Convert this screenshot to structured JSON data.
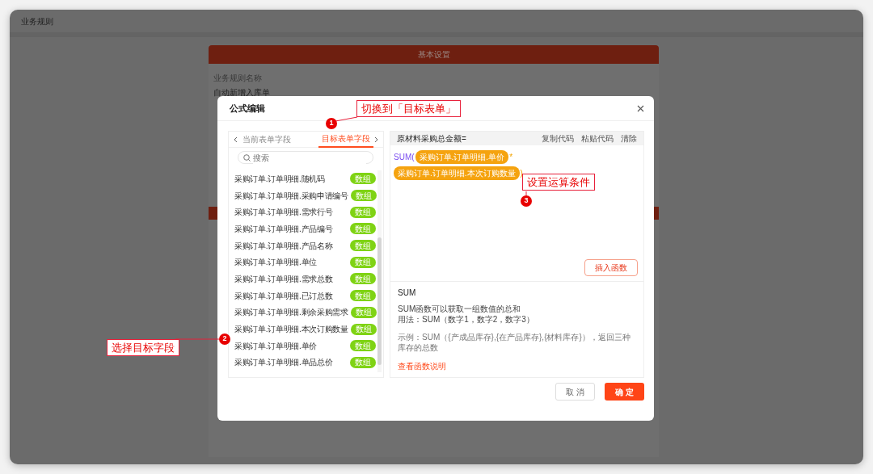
{
  "window": {
    "title": "业务规则"
  },
  "background_form": {
    "section_title": "基本设置",
    "fields": [
      {
        "label": "业务规则名称",
        "value": "自动新增入库单"
      }
    ]
  },
  "dialog": {
    "title": "公式编辑",
    "field_tabs": [
      {
        "label": "当前表单字段",
        "selected": false
      },
      {
        "label": "目标表单字段",
        "selected": true
      }
    ],
    "search": {
      "placeholder": "搜索"
    },
    "fields": [
      {
        "name": "采购订单.订单明细.随机码",
        "badge": "数组"
      },
      {
        "name": "采购订单.订单明细.采购申请编号",
        "badge": "数组"
      },
      {
        "name": "采购订单.订单明细.需求行号",
        "badge": "数组"
      },
      {
        "name": "采购订单.订单明细.产品编号",
        "badge": "数组"
      },
      {
        "name": "采购订单.订单明细.产品名称",
        "badge": "数组"
      },
      {
        "name": "采购订单.订单明细.单位",
        "badge": "数组"
      },
      {
        "name": "采购订单.订单明细.需求总数",
        "badge": "数组"
      },
      {
        "name": "采购订单.订单明细.已订总数",
        "badge": "数组"
      },
      {
        "name": "采购订单.订单明细.剩余采购需求",
        "badge": "数组"
      },
      {
        "name": "采购订单.订单明细.本次订购数量",
        "badge": "数组"
      },
      {
        "name": "采购订单.订单明细.单价",
        "badge": "数组"
      },
      {
        "name": "采购订单.订单明细.单品总价",
        "badge": "数组"
      }
    ],
    "formula": {
      "target": "原材料采购总金额=",
      "actions": [
        "复制代码",
        "粘贴代码",
        "清除"
      ],
      "tokens": [
        {
          "kind": "function",
          "text": "SUM("
        },
        {
          "kind": "field",
          "text": "采购订单.订单明细.单价"
        },
        {
          "kind": "operator",
          "text": "*"
        },
        {
          "kind": "field",
          "text": "采购订单.订单明细.本次订购数量"
        },
        {
          "kind": "operator",
          "text": ")"
        }
      ],
      "insert_button": "插入函数"
    },
    "help": {
      "name": "SUM",
      "lines": [
        "SUM函数可以获取一组数值的总和",
        "用法：SUM（数字1，数字2，数字3）"
      ],
      "example": "示例：SUM（{产成品库存},{在产品库存},{材料库存}），返回三种库存的总数",
      "link": "查看函数说明"
    },
    "buttons": [
      {
        "label": "取 消",
        "kind": "secondary"
      },
      {
        "label": "确 定",
        "kind": "primary"
      }
    ]
  },
  "annotations": [
    {
      "number": "1",
      "text": "切换到「目标表单」"
    },
    {
      "number": "2",
      "text": "选择目标字段"
    },
    {
      "number": "3",
      "text": "设置运算条件"
    }
  ]
}
